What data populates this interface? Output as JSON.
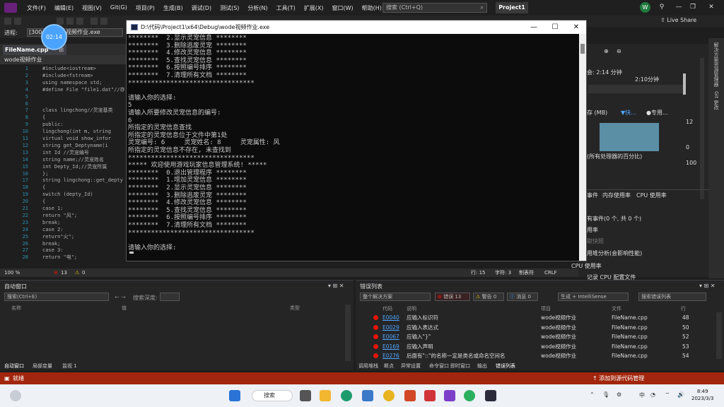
{
  "menu": [
    "文件(F)",
    "编辑(E)",
    "视图(V)",
    "Git(G)",
    "项目(P)",
    "生成(B)",
    "调试(D)",
    "测试(S)",
    "分析(N)",
    "工具(T)",
    "扩展(X)",
    "窗口(W)",
    "帮助(H)"
  ],
  "search_placeholder": "搜索 (Ctrl+Q)",
  "project_title": "Project1",
  "user_initial": "W",
  "live_share": "Live Share",
  "process_label": "进程:",
  "process_id": "[3004",
  "process_exe": "视频作业.exe",
  "timer": "02:14",
  "file_tab": "FileName.cpp",
  "scope": "wode视频作业",
  "code_lines": [
    {
      "n": "1",
      "t": "#include<iostream>"
    },
    {
      "n": "2",
      "t": "#include<fstream>"
    },
    {
      "n": "3",
      "t": "using namespace std;"
    },
    {
      "n": "4",
      "t": "#define File \"file1.dat\"//存"
    },
    {
      "n": "5",
      "t": ""
    },
    {
      "n": "6",
      "t": ""
    },
    {
      "n": "7",
      "t": "class lingchong//灵宠基类"
    },
    {
      "n": "8",
      "t": "{"
    },
    {
      "n": "9",
      "t": "public:"
    },
    {
      "n": "10",
      "t": "  lingchong(int m, string"
    },
    {
      "n": "11",
      "t": "  virtual void show_infor"
    },
    {
      "n": "12",
      "t": "  string get_Deptyname(i"
    },
    {
      "n": "13",
      "t": "  int Id //灵宠编号"
    },
    {
      "n": "14",
      "t": "  string name;//灵宠姓名"
    },
    {
      "n": "15",
      "t": "  int Depty_Id;//灵宠所属"
    },
    {
      "n": "16",
      "t": "};"
    },
    {
      "n": "17",
      "t": "string lingchong::get_depty"
    },
    {
      "n": "18",
      "t": "{"
    },
    {
      "n": "19",
      "t": "  switch (depty_Id)"
    },
    {
      "n": "20",
      "t": "  {"
    },
    {
      "n": "21",
      "t": "  case 1:"
    },
    {
      "n": "22",
      "t": "      return \"风\";"
    },
    {
      "n": "23",
      "t": "      break;"
    },
    {
      "n": "24",
      "t": "  case 2:"
    },
    {
      "n": "25",
      "t": "      return\"火\";"
    },
    {
      "n": "26",
      "t": "      break;"
    },
    {
      "n": "27",
      "t": "  case 3:"
    },
    {
      "n": "28",
      "t": "      return \"电\";"
    }
  ],
  "editor_status": {
    "zoom": "100 %",
    "errors": "13",
    "warnings": "0",
    "line": "行: 15",
    "char": "字符: 3",
    "mode": "制表符",
    "eol": "CRLF"
  },
  "console": {
    "title": "D:\\代码\\Project1\\x64\\Debug\\wode视频作业.exe",
    "lines": [
      "********  2.显示灵宠信息 ********",
      "********  3.删除逃废灵宠 ********",
      "********  4.修改灵宠信息 ********",
      "********  5.查找灵宠信息 ********",
      "********  6.按照编号排序 ********",
      "********  7.清理所有文档 ********",
      "*********************************",
      "",
      "请输入你的选择:",
      "5",
      "请输入所要修改灵宠信息的编号:",
      "6",
      "所指定的灵宠信息查找",
      "所指定的灵宠信息位于文件中第1处",
      "灵宠编号: 6     灵宠姓名: 8     灵宠属性: 风",
      "所指定的灵宠信息不存在, 未查找到",
      "*********************************",
      "***** 欢迎使用游戏玩家信息管理系统! *****",
      "********  0.退出管理程序 ********",
      "********  1.增加灵宠信息 ********",
      "********  2.显示灵宠信息 ********",
      "********  3.删除逃废灵宠 ********",
      "********  4.修改灵宠信息 ********",
      "********  5.查找灵宠信息 ********",
      "********  6.按照编号排序 ********",
      "********  7.清理所有文档 ********",
      "*********************************",
      "",
      "请输入你的选择:",
      ""
    ]
  },
  "diag": {
    "session_time": "会: 2:14 分钟",
    "timeline": "2:10分钟",
    "memory_label": "存 (MB)",
    "snapshot": "▼快...",
    "private": "●专用...",
    "val_12": "12",
    "val_0": "0",
    "cpu_label": "(所有处理器的百分比)",
    "val_100": "100",
    "tabs": [
      "事件",
      "内存使用率",
      "CPU 使用率"
    ],
    "events": "有事件(0 个, 共 0 个)",
    "usage": "用率",
    "take_snapshot": "取快照",
    "analysis": "用堆分析(会影响性能)",
    "cpu_usage": "CPU 使用率",
    "record": "记录 CPU 配置文件"
  },
  "auto_panel": {
    "title": "自动窗口",
    "search": "搜索(Ctrl+E)",
    "search_depth": "搜索深度:",
    "cols": [
      "名称",
      "值",
      "类型"
    ],
    "tabs": [
      "自动窗口",
      "局部变量",
      "监视 1"
    ]
  },
  "err_panel": {
    "title": "错误列表",
    "scope": "整个解决方案",
    "errors": "错误 13",
    "warnings": "警告 0",
    "messages": "消息 0",
    "build": "生成 + IntelliSense",
    "search": "搜索错误列表",
    "cols": [
      "代码",
      "说明",
      "项目",
      "文件",
      "行"
    ],
    "rows": [
      {
        "code": "E0040",
        "desc": "应输入标识符",
        "project": "wode视频作业",
        "file": "FileName.cpp",
        "line": "48"
      },
      {
        "code": "E0029",
        "desc": "应输入表达式",
        "project": "wode视频作业",
        "file": "FileName.cpp",
        "line": "50"
      },
      {
        "code": "E0067",
        "desc": "应输入\"}\"",
        "project": "wode视频作业",
        "file": "FileName.cpp",
        "line": "52"
      },
      {
        "code": "E0169",
        "desc": "应输入声明",
        "project": "wode视频作业",
        "file": "FileName.cpp",
        "line": "53"
      },
      {
        "code": "E0276",
        "desc": "后面有\"::\"的名称一定是类名或命名空间名",
        "project": "wode视频作业",
        "file": "FileName.cpp",
        "line": "54"
      }
    ],
    "tabs": [
      "调用堆栈",
      "断点",
      "异常设置",
      "命令窗口",
      "即时窗口",
      "输出",
      "错误列表"
    ]
  },
  "status": {
    "left": "就绪",
    "source": "添加到源代码管理"
  },
  "taskbar": {
    "search": "搜索",
    "time": "8:49",
    "date": "2023/3/3",
    "lang": "中"
  }
}
